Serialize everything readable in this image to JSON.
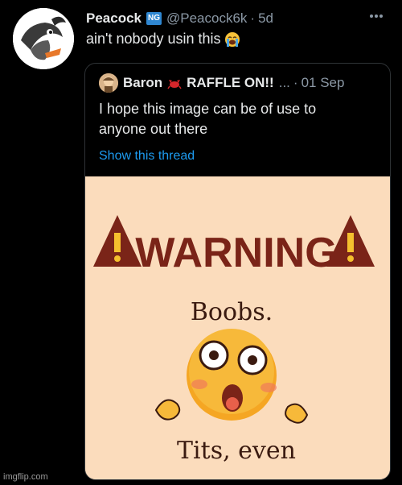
{
  "tweet": {
    "display_name": "Peacock",
    "badge": "NG",
    "handle": "@Peacock6k",
    "separator": "·",
    "time": "5d",
    "text": "ain't nobody usin this",
    "emoji_icon": "loudly-crying-face-icon",
    "more_icon": "more-horizontal-icon"
  },
  "quote": {
    "display_name": "Baron",
    "crab_icon": "crab-icon",
    "display_name_suffix": "RAFFLE ON!!",
    "ellipsis": "...",
    "separator": "·",
    "time": "01 Sep",
    "text_line1": "I hope this image can be of use to",
    "text_line2": "anyone out there",
    "show_thread": "Show this thread",
    "image": {
      "heading": "WARNING",
      "line1": "Boobs.",
      "line2": "Tits, even",
      "warning_icon": "warning-triangle-icon",
      "background_color": "#fbdcbc",
      "accent_color": "#7a2418"
    }
  },
  "watermark": "imgflip.com",
  "colors": {
    "background": "#000000",
    "text": "#e7e9ea",
    "muted": "#8b98a5",
    "link": "#1d9bf0",
    "border": "#2f3336"
  }
}
